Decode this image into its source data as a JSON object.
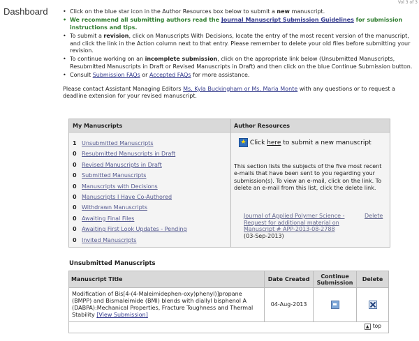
{
  "page": {
    "title": "Dashboard",
    "corner_text": "Vol 3 of 3"
  },
  "intro": {
    "b1_pre": "Click on the blue star icon in the Author Resources box below to submit a ",
    "b1_bold": "new",
    "b1_post": " manuscript.",
    "b2_pre": "We recommend all submitting authors read the ",
    "b2_link": "Journal Manuscript Submission Guidelines",
    "b2_post": " for submission instructions and tips.",
    "b3_pre": "To submit a ",
    "b3_bold": "revision",
    "b3_post": ", click on Manuscripts With Decisions, locate the entry of the most recent version of the manuscript, and click the link in the Action column next to that entry. Please remember to delete your old files before submitting your revision.",
    "b4_pre": "To continue working on an ",
    "b4_bold": "incomplete submission",
    "b4_post": ", click on the appropriate link below (Unsubmitted Manuscripts, Resubmitted Manuscripts in Draft or Revised Manuscripts in Draft) and then click on the blue Continue Submission button.",
    "b5_pre": "Consult ",
    "b5_link1": "Submission FAQs",
    "b5_mid": " or ",
    "b5_link2": "Accepted FAQs",
    "b5_post": " for more assistance.",
    "contact_pre": "Please contact Assistant Managing Editors ",
    "contact_link": "Ms. Kyla Buckingham or Ms. Maria Monte",
    "contact_post": " with any questions or to request a deadline extension for your revised manuscript."
  },
  "my_manuscripts": {
    "header": "My Manuscripts",
    "items": [
      {
        "count": "1",
        "label": "Unsubmitted Manuscripts"
      },
      {
        "count": "0",
        "label": "Resubmitted Manuscripts in Draft"
      },
      {
        "count": "0",
        "label": "Revised Manuscripts in Draft"
      },
      {
        "count": "0",
        "label": "Submitted Manuscripts"
      },
      {
        "count": "0",
        "label": "Manuscripts with Decisions"
      },
      {
        "count": "0",
        "label": "Manuscripts I Have Co-Authored"
      },
      {
        "count": "0",
        "label": "Withdrawn Manuscripts"
      },
      {
        "count": "0",
        "label": "Awaiting Final Files"
      },
      {
        "count": "0",
        "label": "Awaiting First Look Updates - Pending"
      },
      {
        "count": "0",
        "label": "Invited Manuscripts"
      }
    ]
  },
  "author_resources": {
    "header": "Author Resources",
    "star_icon": "blue-star-icon",
    "click_pre": "Click ",
    "click_link": "here",
    "click_post": " to submit a new manuscript",
    "description": "This section lists the subjects of the five most recent e-mails that have been sent to you regarding your submission(s). To view an e-mail, click on the link. To delete an e-mail from this list, click the delete link.",
    "email_subject": "Journal of Applied Polymer Science - Request for additional material on Manuscript # APP-2013-08-2788",
    "email_date": "(03-Sep-2013)",
    "email_delete": "Delete"
  },
  "unsubmitted": {
    "title": "Unsubmitted Manuscripts",
    "columns": {
      "title": "Manuscript Title",
      "date": "Date Created",
      "continue": "Continue Submission",
      "delete": "Delete"
    },
    "rows": [
      {
        "title": "Modification of Bis[4-(4-Maleimidephen-oxy)phenyl)]propane (BMPP) and Bismaleimide (BMI) blends with diallyl bisphenol A (DABPA):Mechanical Properties, Fracture Toughness and Thermal Stability",
        "view_link": "[View Submission]",
        "date": "04-Aug-2013"
      }
    ],
    "top_link": "top"
  }
}
